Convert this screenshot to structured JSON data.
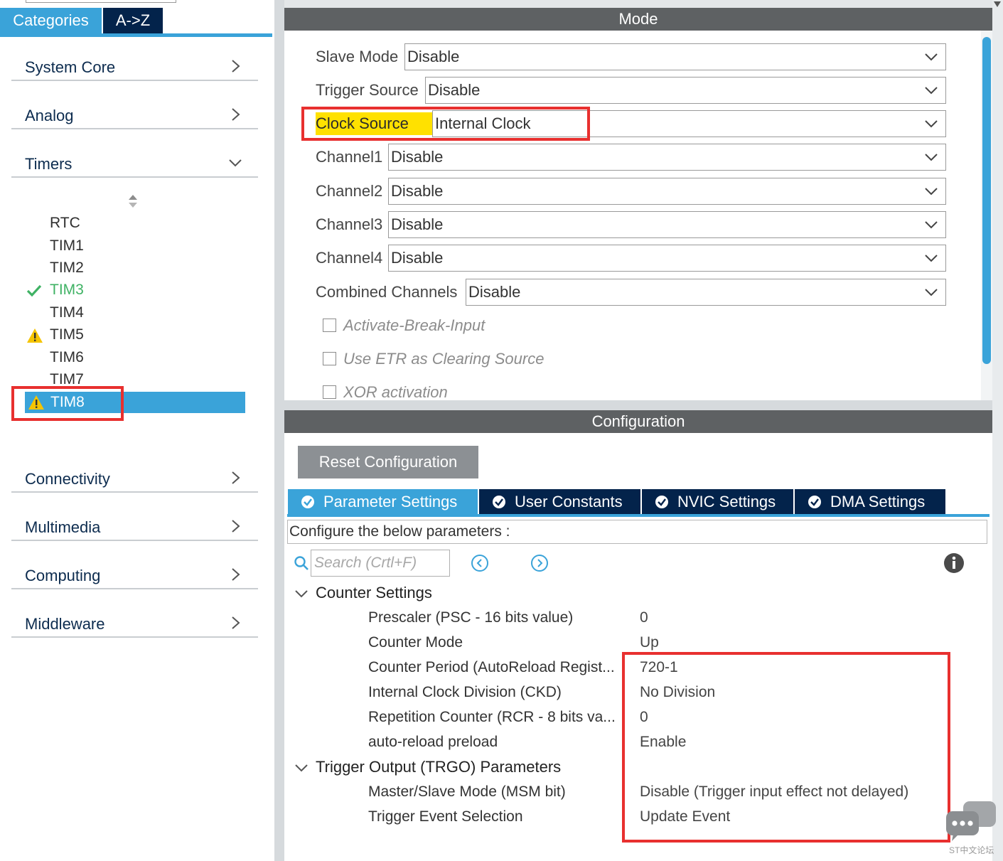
{
  "sidebar": {
    "tabs": {
      "categories": "Categories",
      "az": "A->Z"
    },
    "categories": {
      "system_core": "System Core",
      "analog": "Analog",
      "timers": "Timers",
      "connectivity": "Connectivity",
      "multimedia": "Multimedia",
      "computing": "Computing",
      "middleware": "Middleware"
    },
    "timers": [
      {
        "label": "RTC",
        "status": "none"
      },
      {
        "label": "TIM1",
        "status": "none"
      },
      {
        "label": "TIM2",
        "status": "none"
      },
      {
        "label": "TIM3",
        "status": "ok"
      },
      {
        "label": "TIM4",
        "status": "none"
      },
      {
        "label": "TIM5",
        "status": "warning"
      },
      {
        "label": "TIM6",
        "status": "none"
      },
      {
        "label": "TIM7",
        "status": "none"
      },
      {
        "label": "TIM8",
        "status": "warning",
        "selected": true
      }
    ]
  },
  "mode": {
    "title": "Mode",
    "fields": {
      "slave_mode": {
        "label": "Slave Mode",
        "value": "Disable"
      },
      "trigger_source": {
        "label": "Trigger Source",
        "value": "Disable"
      },
      "clock_source": {
        "label": "Clock Source",
        "value": "Internal Clock"
      },
      "channel1": {
        "label": "Channel1",
        "value": "Disable"
      },
      "channel2": {
        "label": "Channel2",
        "value": "Disable"
      },
      "channel3": {
        "label": "Channel3",
        "value": "Disable"
      },
      "channel4": {
        "label": "Channel4",
        "value": "Disable"
      },
      "combined": {
        "label": "Combined Channels",
        "value": "Disable"
      }
    },
    "checkboxes": {
      "break_input": "Activate-Break-Input",
      "etr_clearing": "Use ETR as Clearing Source",
      "xor": "XOR activation"
    }
  },
  "configuration": {
    "title": "Configuration",
    "reset_label": "Reset Configuration",
    "tabs": {
      "parameter": "Parameter Settings",
      "user_constants": "User Constants",
      "nvic": "NVIC Settings",
      "dma": "DMA Settings"
    },
    "configure_text": "Configure the below parameters :",
    "search_placeholder": "Search (Crtl+F)",
    "groups": {
      "counter": {
        "title": "Counter Settings",
        "params": {
          "prescaler": {
            "name": "Prescaler (PSC - 16 bits value)",
            "value": "0"
          },
          "counter_mode": {
            "name": "Counter Mode",
            "value": "Up"
          },
          "period": {
            "name": "Counter Period (AutoReload Regist...",
            "value": "720-1"
          },
          "ckd": {
            "name": "Internal Clock Division (CKD)",
            "value": "No Division"
          },
          "rcr": {
            "name": "Repetition Counter (RCR - 8 bits va...",
            "value": "0"
          },
          "preload": {
            "name": "auto-reload preload",
            "value": "Enable"
          }
        }
      },
      "trgo": {
        "title": "Trigger Output (TRGO) Parameters",
        "params": {
          "msm": {
            "name": "Master/Slave Mode (MSM bit)",
            "value": "Disable (Trigger input effect not delayed)"
          },
          "trigger_event": {
            "name": "Trigger Event Selection",
            "value": "Update Event"
          }
        }
      }
    }
  },
  "watermark": "ST中文论坛",
  "colors": {
    "accent_blue": "#3aa3d9",
    "navy": "#03234b",
    "header_gray": "#5e6163",
    "highlight_red": "#e8302f",
    "highlight_yellow": "#ffe100",
    "ok_green": "#3fb264",
    "warning_yellow": "#f5c400"
  }
}
